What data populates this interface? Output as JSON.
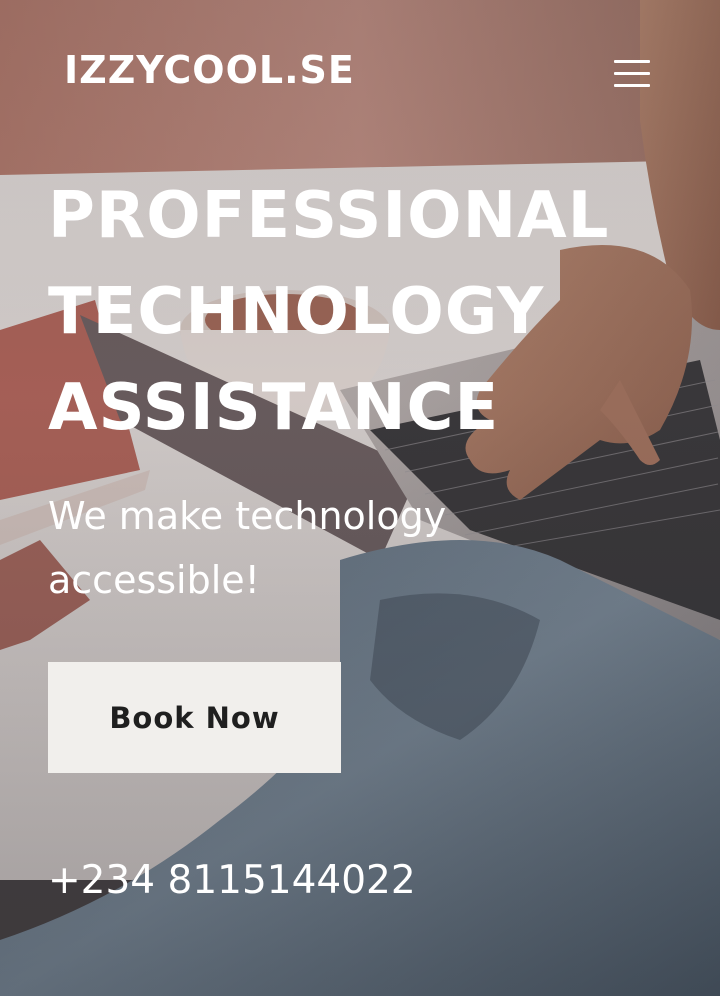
{
  "header": {
    "logo_text": "IZZYCOOL.SE",
    "menu_icon": "hamburger-menu-icon"
  },
  "hero": {
    "headline_lines": [
      "PROFESSIONAL",
      "TECHNOLOGY",
      "ASSISTANCE"
    ],
    "tagline_lines": [
      "We make technology",
      "accessible!"
    ],
    "cta_label": "Book Now",
    "phone": "+234 8115144022"
  },
  "colors": {
    "text": "#ffffff",
    "button_bg": "#f1efec",
    "button_text": "#1f1f1f"
  }
}
